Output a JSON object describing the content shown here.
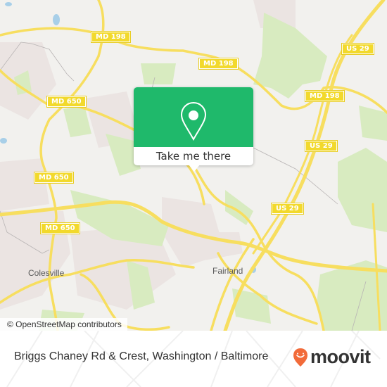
{
  "map": {
    "road_shields": [
      {
        "label": "MD 198"
      },
      {
        "label": "MD 198"
      },
      {
        "label": "MD 198"
      },
      {
        "label": "US 29"
      },
      {
        "label": "US 29"
      },
      {
        "label": "MD 650"
      },
      {
        "label": "MD 650"
      },
      {
        "label": "MD 650"
      },
      {
        "label": "US 29"
      }
    ],
    "places": [
      {
        "label": "Colesville"
      },
      {
        "label": "Fairland"
      }
    ],
    "attribution": "© OpenStreetMap contributors",
    "colors": {
      "background": "#f2f1ee",
      "park": "#d8ebc0",
      "residential": "#ebe4e2",
      "road": "#f7de5f",
      "popup": "#1fb96b"
    }
  },
  "popup": {
    "icon": "location-pin-icon",
    "button_label": "Take me there"
  },
  "footer": {
    "title": "Briggs Chaney Rd & Crest, Washington / Baltimore",
    "brand": "moovit",
    "brand_color": "#f26b3a"
  }
}
